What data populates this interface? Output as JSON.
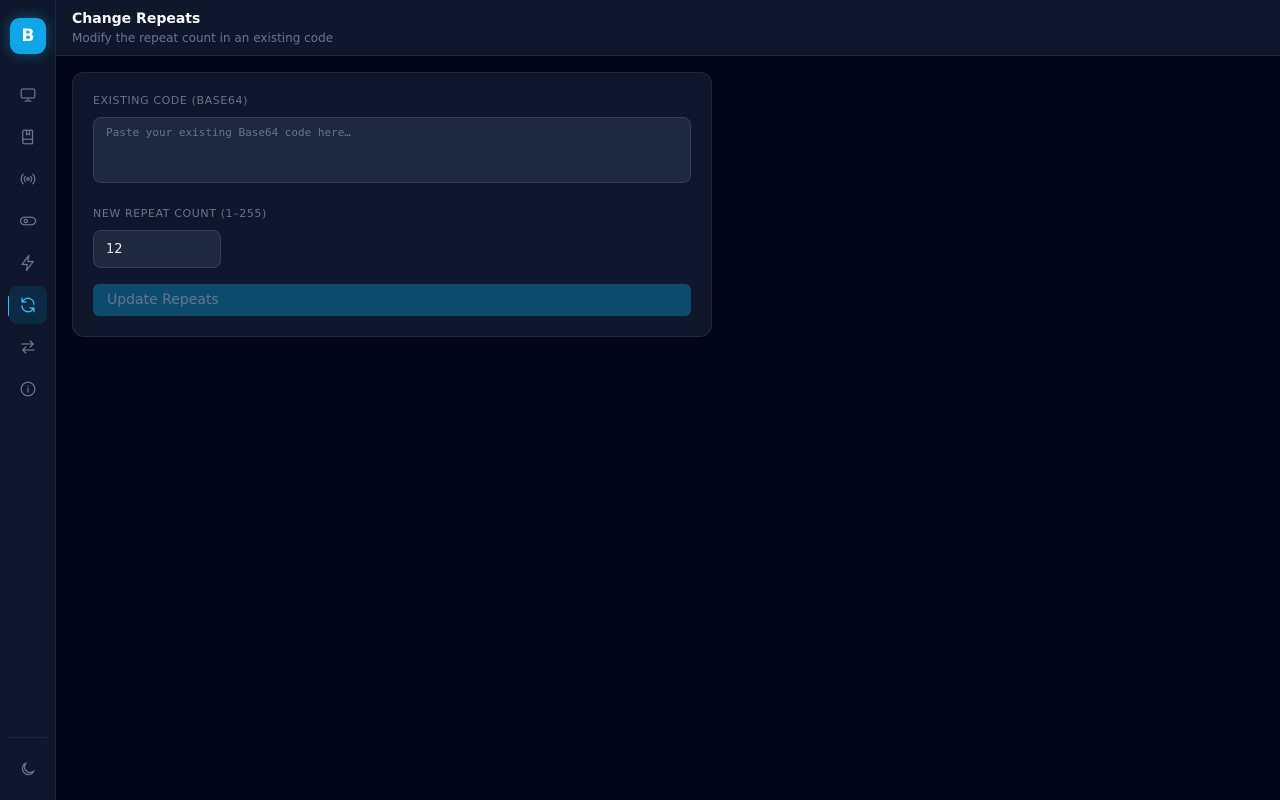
{
  "sidebar": {
    "logo_letter": "B",
    "items": [
      {
        "icon": "monitor-icon"
      },
      {
        "icon": "book-icon"
      },
      {
        "icon": "broadcast-icon"
      },
      {
        "icon": "toggle-icon"
      },
      {
        "icon": "lightning-icon"
      },
      {
        "icon": "refresh-icon",
        "active": true
      },
      {
        "icon": "swap-arrows-icon"
      },
      {
        "icon": "info-icon"
      }
    ],
    "footer_icon": "moon-icon"
  },
  "header": {
    "title": "Change Repeats",
    "subtitle": "Modify the repeat count in an existing code"
  },
  "form": {
    "code_label": "EXISTING CODE (BASE64)",
    "code_placeholder": "Paste your existing Base64 code here…",
    "code_value": "",
    "repeat_label": "NEW REPEAT COUNT (1–255)",
    "repeat_value": "12",
    "submit_label": "Update Repeats"
  },
  "colors": {
    "accent": "#38bdf8",
    "logo_bg": "#0ea5e9",
    "background": "#020617",
    "panel": "#0f172a",
    "button_disabled": "#0c4a6e"
  }
}
